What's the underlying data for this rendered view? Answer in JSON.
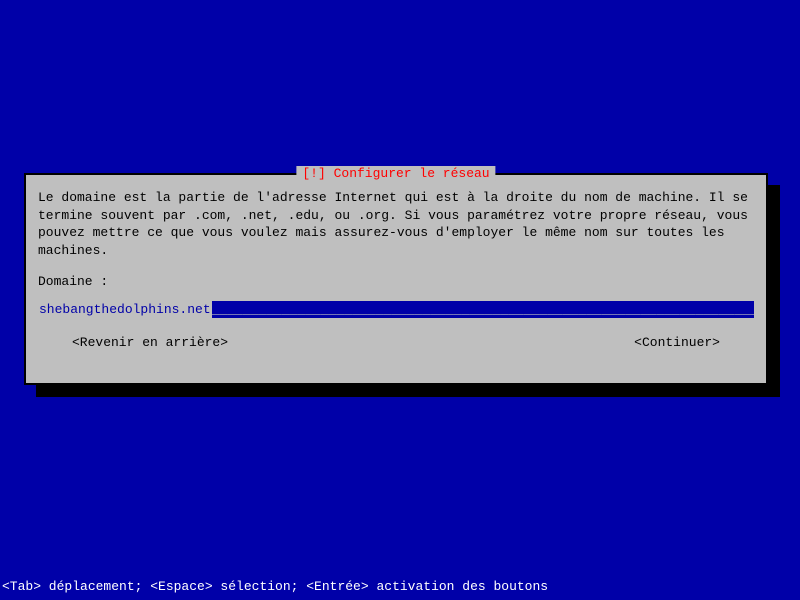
{
  "dialog": {
    "title": "[!] Configurer le réseau",
    "description": "Le domaine est la partie de l'adresse Internet qui est à la droite du nom de machine. Il se termine souvent par .com, .net, .edu, ou .org. Si vous paramétrez votre propre réseau, vous pouvez mettre ce que vous voulez mais assurez-vous d'employer le même nom sur toutes les machines.",
    "field_label": "Domaine :",
    "input_value": "shebangthedolphins.net",
    "input_fill": "________________________________________________________________________",
    "buttons": {
      "back": "<Revenir en arrière>",
      "continue": "<Continuer>"
    }
  },
  "statusbar": "<Tab> déplacement; <Espace> sélection; <Entrée> activation des boutons"
}
